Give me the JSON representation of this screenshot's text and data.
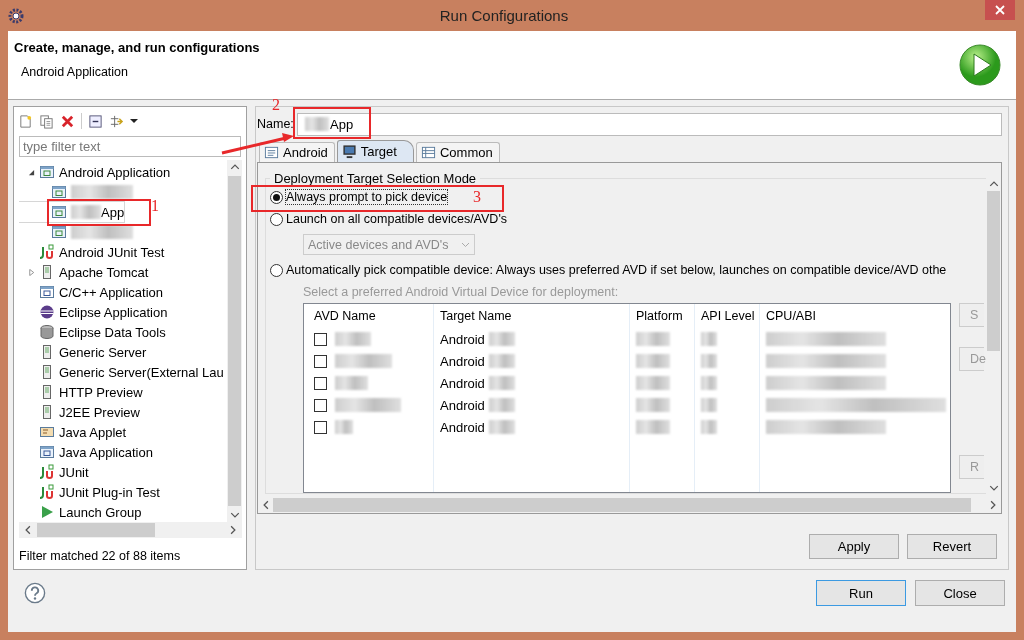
{
  "window": {
    "title": "Run Configurations"
  },
  "header": {
    "title": "Create, manage, and run configurations",
    "subtitle": "Android Application"
  },
  "filter": {
    "placeholder": "type filter text"
  },
  "tree": [
    {
      "label": "Android Application",
      "kind": "android",
      "expanded": true,
      "children": [
        {
          "blurred": true,
          "selected": false
        },
        {
          "label": "App",
          "blurred": true,
          "selected": true
        },
        {
          "blurred": true,
          "selected": false
        }
      ]
    },
    {
      "label": "Android JUnit Test",
      "kind": "junit"
    },
    {
      "label": "Apache Tomcat",
      "kind": "server",
      "expanded": false
    },
    {
      "label": "C/C++ Application",
      "kind": "cpp"
    },
    {
      "label": "Eclipse Application",
      "kind": "eclipse"
    },
    {
      "label": "Eclipse Data Tools",
      "kind": "database"
    },
    {
      "label": "Generic Server",
      "kind": "server"
    },
    {
      "label": "Generic Server(External Lau",
      "kind": "server"
    },
    {
      "label": "HTTP Preview",
      "kind": "server"
    },
    {
      "label": "J2EE Preview",
      "kind": "server"
    },
    {
      "label": "Java Applet",
      "kind": "applet"
    },
    {
      "label": "Java Application",
      "kind": "java"
    },
    {
      "label": "JUnit",
      "kind": "junit"
    },
    {
      "label": "JUnit Plug-in Test",
      "kind": "junit"
    },
    {
      "label": "Launch Group",
      "kind": "launch"
    }
  ],
  "filter_status": "Filter matched 22 of 88 items",
  "name_field": {
    "label": "Name:",
    "value": "App",
    "blurred": true
  },
  "tabs": [
    {
      "label": "Android",
      "selected": false
    },
    {
      "label": "Target",
      "selected": true
    },
    {
      "label": "Common",
      "selected": false
    }
  ],
  "section_title": "Deployment Target Selection Mode",
  "modes": [
    {
      "label": "Always prompt to pick device",
      "selected": true
    },
    {
      "label": "Launch on all compatible devices/AVD's",
      "selected": false
    },
    {
      "label": "Automatically pick compatible device: Always uses preferred AVD if set below, launches on compatible device/AVD othe",
      "selected": false
    }
  ],
  "device_select": {
    "value": "Active devices and AVD's",
    "disabled": true
  },
  "avd_hint": "Select a preferred Android Virtual Device for deployment:",
  "avd_table": {
    "columns": [
      "AVD Name",
      "Target Name",
      "Platform",
      "API Level",
      "CPU/ABI"
    ],
    "rows": [
      {
        "checked": false,
        "target": "Android"
      },
      {
        "checked": false,
        "target": "Android"
      },
      {
        "checked": false,
        "target": "Android"
      },
      {
        "checked": false,
        "target": "Android"
      },
      {
        "checked": false,
        "target": "Android"
      }
    ]
  },
  "side_buttons": [
    "S",
    "De",
    "R"
  ],
  "buttons": [
    "Apply",
    "Revert"
  ],
  "dialog_buttons": [
    {
      "label": "Run",
      "default": true
    },
    {
      "label": "Close",
      "default": false
    }
  ],
  "annotations": [
    {
      "label": "1"
    },
    {
      "label": "2"
    },
    {
      "label": "3"
    }
  ]
}
